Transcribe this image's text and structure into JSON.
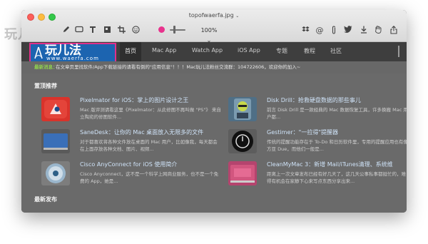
{
  "background_logo": "玩儿法",
  "window": {
    "title": "topofwaerfa.jpg",
    "zoom": "100%"
  },
  "site": {
    "logo_name": "玩儿法",
    "logo_url": "www.waerfa.com",
    "nav": [
      "首页",
      "Mac App",
      "Watch App",
      "iOS App",
      "专题",
      "教程",
      "社区"
    ],
    "notice_label": "最新消息：",
    "notice_text": "在文章页里找软件/App下载链接的请看有倒的\"应用信息\"！！！Mac玩儿法粉丝交流群：104722606，欢迎你的加入~",
    "sticky_title": "置顶推荐",
    "latest_title": "最新发布",
    "articles": [
      {
        "title": "Pixelmator for iOS：掌上的图片设计之王",
        "desc": "Mac 版评测请看这里《Pixelmator：从此修图不再叫做 \"PS\"》 来自立陶宛的修图软件..."
      },
      {
        "title": "Disk Drill：抢救硬盘数据的那些事儿",
        "desc": "前言 Disk Drill 是一款经典的 Mac 数据恢复工具，许多换搬 Mac 用户都..."
      },
      {
        "title": "SaneDesk：让你的 Mac 桌面放入无限多的文件",
        "desc": "对于都喜欢将各种文件放在桌面的 Mac 用户，比如像我，每天都会在上面存放各种文档、图片、视频..."
      },
      {
        "title": "Gestimer：\"一拉得\"提醒器",
        "desc": "传统的提醒功能存在于 To-Do 和日历软件里，专用的提醒应用也有像方亚 Due，而他们一般是..."
      },
      {
        "title": "Cisco AnyConnect for iOS 使用简介",
        "desc": "Cisco Anyconnect，这不是一个科学上网商业服务，也不是一个免费的 App，她是..."
      },
      {
        "title": "CleanMyMac 3：新增 Mail/iTunes清理、系统维",
        "desc": "距离上一次文章发布已经有好几天了，这几天公事私事都挺忙的，难得有机会在家静下心来写点东西分享出来..."
      }
    ]
  },
  "colors": {
    "logo_bg": "#1c64b0",
    "logo_border": "#e1308a",
    "notice_label": "#8fd14f",
    "toolbar_color_dot": "#e8338d"
  },
  "icons": {
    "toolbar_left": [
      "pen-icon",
      "rectangle-icon",
      "text-icon",
      "adjust-icon",
      "crop-icon",
      "emoji-icon"
    ],
    "toolbar_right": [
      "dropbox-icon",
      "at-icon",
      "clip-icon",
      "twitter-icon",
      "download-icon",
      "hand-icon",
      "share-icon"
    ]
  }
}
